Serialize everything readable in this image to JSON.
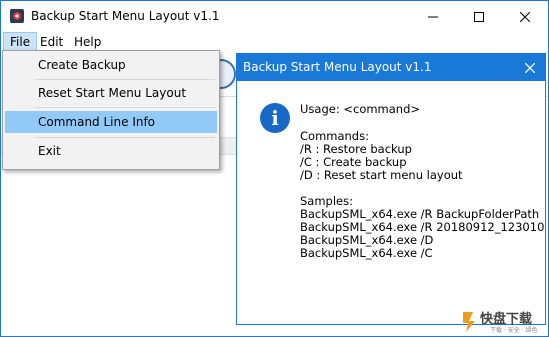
{
  "window": {
    "title": "Backup Start Menu Layout v1.1"
  },
  "menubar": {
    "items": [
      "File",
      "Edit",
      "Help"
    ]
  },
  "file_menu": {
    "items": [
      "Create Backup",
      "Reset Start Menu Layout",
      "Command Line Info",
      "Exit"
    ],
    "highlighted": "Command Line Info"
  },
  "dialog": {
    "title": "Backup Start Menu Layout v1.1",
    "usage": "Usage: <command>",
    "commands_heading": "Commands:",
    "commands": [
      "/R : Restore backup",
      "/C : Create backup",
      "/D : Reset start menu layout"
    ],
    "samples_heading": "Samples:",
    "samples": [
      "BackupSML_x64.exe /R BackupFolderPath",
      "BackupSML_x64.exe /R 20180912_123010",
      "BackupSML_x64.exe /D",
      "BackupSML_x64.exe /C"
    ]
  },
  "watermark": {
    "text": "快盘下载",
    "sub": "下载 · 安全 · 绿色"
  },
  "colors": {
    "accent": "#1a78d6",
    "menu_highlight": "#91c9f7",
    "info": "#1769c8"
  },
  "icons": [
    "app-icon",
    "minimize-icon",
    "maximize-icon",
    "close-icon",
    "info-icon",
    "toolbar-icon"
  ]
}
